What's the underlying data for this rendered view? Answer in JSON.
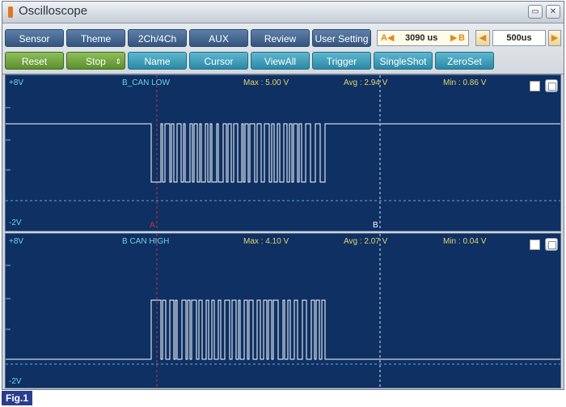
{
  "window": {
    "title": "Oscilloscope"
  },
  "toolbar": {
    "row1": [
      "Sensor",
      "Theme",
      "2Ch/4Ch",
      "AUX",
      "Review",
      "User Setting"
    ],
    "row2": [
      "Reset",
      "Stop",
      "Name",
      "Cursor",
      "ViewAll",
      "Trigger",
      "SingleShot",
      "ZeroSet"
    ],
    "cursor_a": "A",
    "cursor_b": "B",
    "cursor_delta": "3090 us",
    "timebase": "500us"
  },
  "channels": [
    {
      "name": "B_CAN LOW",
      "vmax_label": "+8V",
      "vmin_label": "-2V",
      "max": "Max : 5.00 V",
      "avg": "Avg : 2.94 V",
      "min": "Min : 0.86 V"
    },
    {
      "name": "B CAN HIGH",
      "vmax_label": "+8V",
      "vmin_label": "-2V",
      "max": "Max : 4.10 V",
      "avg": "Avg : 2.07 V",
      "min": "Min : 0.04 V"
    }
  ],
  "cursor_labels": {
    "a": "A",
    "b": "B"
  },
  "figure_label": "Fig.1",
  "colors": {
    "screen": "#0e3063",
    "trace": "#ffffff",
    "cursor_a": "#d23030",
    "cursor_b": "#d8e4f4"
  }
}
